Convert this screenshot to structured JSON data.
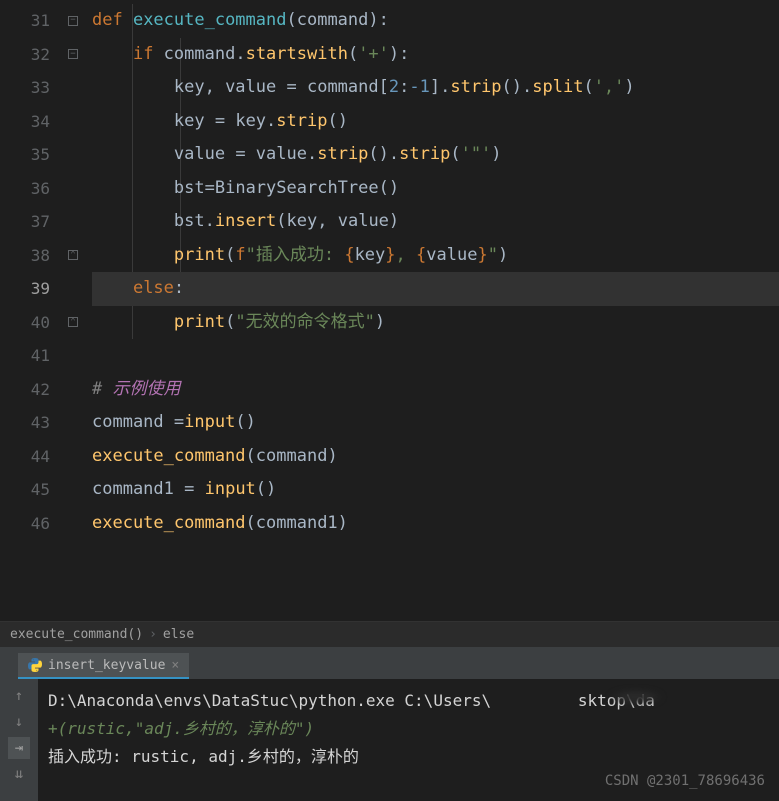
{
  "code": {
    "lines": [
      {
        "num": "31",
        "fold": "down"
      },
      {
        "num": "32",
        "fold": "down"
      },
      {
        "num": "33",
        "fold": ""
      },
      {
        "num": "34",
        "fold": ""
      },
      {
        "num": "35",
        "fold": ""
      },
      {
        "num": "36",
        "fold": ""
      },
      {
        "num": "37",
        "fold": ""
      },
      {
        "num": "38",
        "fold": "up"
      },
      {
        "num": "39",
        "fold": "",
        "current": true
      },
      {
        "num": "40",
        "fold": "up"
      },
      {
        "num": "41",
        "fold": ""
      },
      {
        "num": "42",
        "fold": ""
      },
      {
        "num": "43",
        "fold": ""
      },
      {
        "num": "44",
        "fold": ""
      },
      {
        "num": "45",
        "fold": ""
      },
      {
        "num": "46",
        "fold": ""
      }
    ],
    "l31": {
      "def": "def ",
      "fn": "execute_command",
      "p1": "(",
      "param": "command",
      "p2": "):"
    },
    "l32": {
      "if": "if ",
      "var": "command",
      "dot": ".",
      "method": "startswith",
      "p1": "(",
      "str": "'+'",
      "p2": "):"
    },
    "l33": {
      "vars": "key, value ",
      "eq": "= ",
      "cmd": "command",
      "b1": "[",
      "n1": "2",
      "colon": ":",
      "n2": "-1",
      "b2": "].",
      "m1": "strip",
      "p1": "().",
      "m2": "split",
      "p2": "(",
      "str": "','",
      "p3": ")"
    },
    "l34": {
      "var1": "key ",
      "eq": "= ",
      "var2": "key",
      "dot": ".",
      "method": "strip",
      "p": "()"
    },
    "l35": {
      "var1": "value ",
      "eq": "= ",
      "var2": "value",
      "dot1": ".",
      "m1": "strip",
      "p1": "().",
      "m2": "strip",
      "p2": "(",
      "str": "'\"'",
      "p3": ")"
    },
    "l36": {
      "var": "bst",
      "eq": "=",
      "cls": "BinarySearchTree",
      "p": "()"
    },
    "l37": {
      "var": "bst",
      "dot": ".",
      "method": "insert",
      "p1": "(",
      "a1": "key",
      "comma": ", ",
      "a2": "value",
      "p2": ")"
    },
    "l38": {
      "fn": "print",
      "p1": "(",
      "f": "f",
      "q1": "\"",
      "s1": "插入成功: ",
      "b1": "{",
      "v1": "key",
      "b2": "}",
      "s2": ", ",
      "b3": "{",
      "v2": "value",
      "b4": "}",
      "q2": "\"",
      "p2": ")"
    },
    "l39": {
      "else": "else",
      "colon": ":"
    },
    "l40": {
      "fn": "print",
      "p1": "(",
      "str": "\"无效的命令格式\"",
      "p2": ")"
    },
    "l42": {
      "hash": "# ",
      "text": "示例使用"
    },
    "l43": {
      "var": "command ",
      "eq": "=",
      "fn": "input",
      "p": "()"
    },
    "l44": {
      "fn": "execute_command",
      "p1": "(",
      "arg": "command",
      "p2": ")"
    },
    "l45": {
      "var": "command1 ",
      "eq": "= ",
      "fn": "input",
      "p": "()"
    },
    "l46": {
      "fn": "execute_command",
      "p1": "(",
      "arg": "command1",
      "p2": ")"
    }
  },
  "breadcrumb": {
    "item1": "execute_command()",
    "item2": "else"
  },
  "tab": {
    "name": "insert_keyvalue",
    "close": "×"
  },
  "terminal": {
    "line1_a": "D:\\Anaconda\\envs\\DataStuc\\python.exe C:\\Users\\",
    "line1_b": "sktop\\da",
    "line2": "+(rustic,\"adj.乡村的，淳朴的\")",
    "line3": "插入成功: rustic, adj.乡村的，淳朴的"
  },
  "watermark": "CSDN @2301_78696436"
}
